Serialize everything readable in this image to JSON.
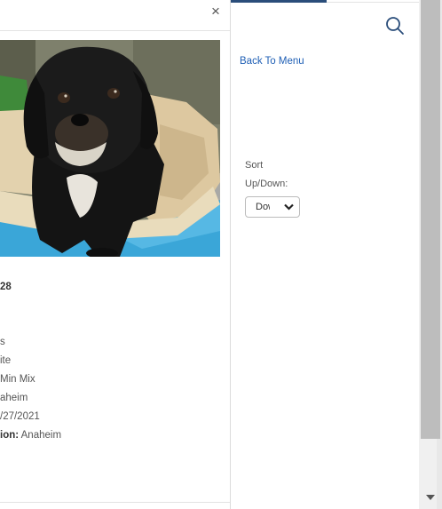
{
  "modal": {
    "close_label": "×",
    "photo_alt": "black dog",
    "details": {
      "id_fragment": "28",
      "line_s": "s",
      "color": "ite",
      "breed": "Min Mix",
      "city": "aheim",
      "date": "/27/2021",
      "location_label": "ion:",
      "location_value": "Anaheim"
    }
  },
  "nav": {
    "back_to_menu": "Back To Menu",
    "search_icon": "search-icon"
  },
  "sort": {
    "label_line1": "Sort",
    "label_line2": "Up/Down:",
    "selected": "Down"
  },
  "colors": {
    "accent": "#2a4d7a",
    "link": "#1f5fb5"
  }
}
